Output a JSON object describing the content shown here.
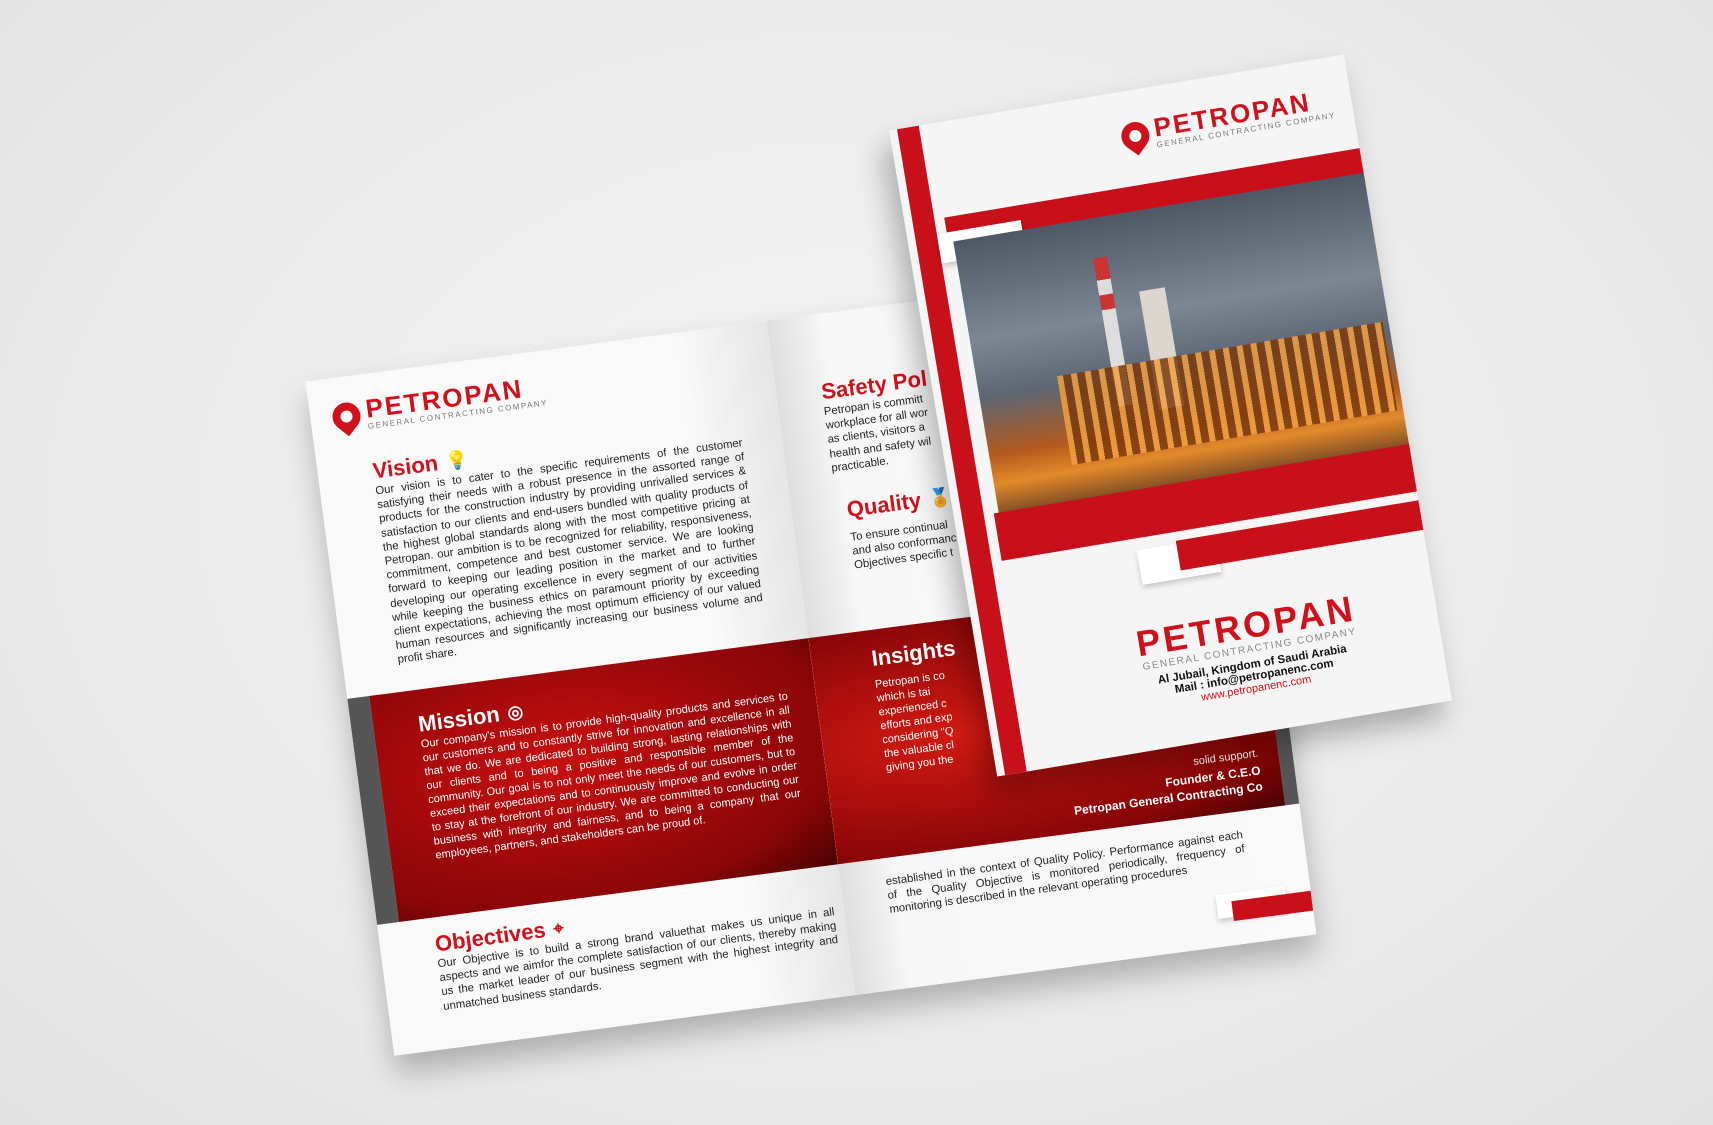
{
  "brand": {
    "name": "PETROPAN",
    "tagline": "GENERAL CONTRACTING COMPANY",
    "accent": "#d0101a"
  },
  "spread": {
    "vision": {
      "title": "Vision",
      "icon": "lightbulb-icon",
      "text": "Our vision is to cater to the specific requirements of the customer satisfying their needs with a robust presence in the assorted range of products for the construction industry by providing unrivalled services & satisfaction to our clients and end-users bundled with quality products of the highest global standards along with the most competitive pricing at Petropan. our ambition is to be recognized for reliability, responsiveness, commitment, competence and best customer service. We are looking forward to keeping our leading position in the market and to further developing our operating excellence in every segment of our activities while keeping the business ethics on paramount priority by exceeding client expectations, achieving the most optimum efficiency of our valued human resources and significantly increasing our business volume and profit share."
    },
    "mission": {
      "title": "Mission",
      "icon": "target-icon",
      "text": "Our company's mission is to provide high-quality products and services to our customers and to constantly strive for innovation and excellence in all that we do. We are dedicated to building strong, lasting relationships with our clients and to being a positive and responsible member of the community. Our goal is to not only meet the needs of our customers, but to exceed their expectations and to continuously improve and evolve in order to stay at the forefront of our industry. We are committed to conducting our business with integrity and fairness, and to being a company that our employees, partners, and stakeholders can be proud of."
    },
    "objectives": {
      "title": "Objectives",
      "icon": "crosshair-icon",
      "text": "Our Objective is to build a strong brand valuethat makes us unique in all aspects and we aimfor the complete satisfaction of our clients, thereby making us the market leader of our business segment with the highest integrity and unmatched business standards."
    },
    "safety": {
      "title": "Safety Pol",
      "lines": [
        "Petropan is committ",
        "workplace for all wor",
        "as clients, visitors a",
        "health and safety wil",
        "practicable."
      ]
    },
    "quality": {
      "title": "Quality",
      "icon": "award-ribbon-icon",
      "lines": [
        "To ensure continual",
        "and also conformanc",
        "Objectives specific t"
      ]
    },
    "insights": {
      "title": "Insights",
      "lines": [
        "Petropan is co",
        "which is tai",
        "experienced c",
        "efforts and exp",
        "considering \"Q",
        "the valuable cl",
        "giving you the"
      ],
      "tail": "solid support.",
      "signature_role": "Founder & C.E.O",
      "signature_company": "Petropan General Contracting Co"
    },
    "quality_cont": "established in the context of Quality Policy. Performance against each of the Quality Objective is monitored periodically, frequency of monitoring is described in the relevant operating procedures"
  },
  "cover": {
    "address": "Al Jubail, Kingdom of Saudi Arabia",
    "mail": "Mail : info@petropanenc.com",
    "website": "www.petropanenc.com"
  }
}
